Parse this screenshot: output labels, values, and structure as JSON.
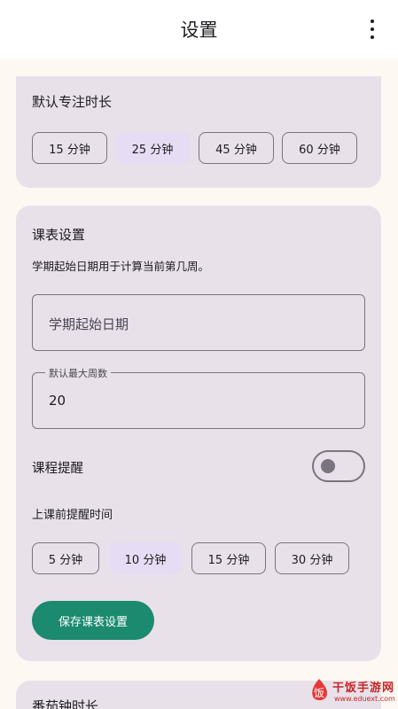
{
  "appbar": {
    "title": "设置",
    "menu_icon": "more-vert-icon"
  },
  "focus_duration": {
    "title": "默认专注时长",
    "options": [
      "15 分钟",
      "25 分钟",
      "45 分钟",
      "60 分钟"
    ],
    "selected": "25 分钟"
  },
  "schedule": {
    "title": "课表设置",
    "description": "学期起始日期用于计算当前第几周。",
    "start_date": {
      "placeholder": "学期起始日期",
      "value": ""
    },
    "max_weeks": {
      "label": "默认最大周数",
      "value": "20"
    },
    "reminder": {
      "label": "课程提醒",
      "enabled": false
    },
    "reminder_time": {
      "label": "上课前提醒时间",
      "options": [
        "5 分钟",
        "10 分钟",
        "15 分钟",
        "30 分钟"
      ],
      "selected": "10 分钟"
    },
    "save_label": "保存课表设置"
  },
  "pomodoro": {
    "title": "番茄钟时长"
  },
  "watermark": {
    "name": "干饭手游网",
    "url": "www.eduext.com",
    "logo_glyph": "饭"
  },
  "colors": {
    "primary": "#1b8a6f",
    "card": "#e8e1ea",
    "selected_chip": "#e6ddf4",
    "outline": "#79747e"
  }
}
